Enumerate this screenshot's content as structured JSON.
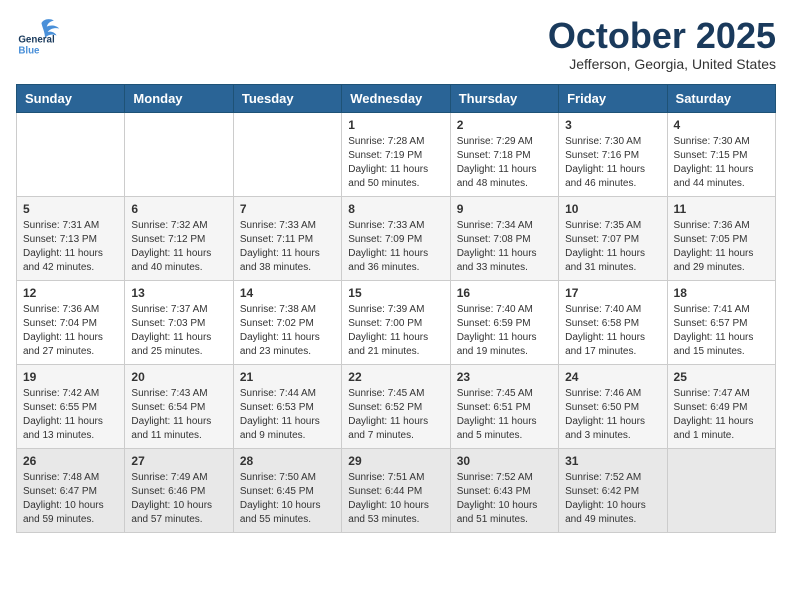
{
  "header": {
    "logo_line1": "General",
    "logo_line2": "Blue",
    "month": "October 2025",
    "location": "Jefferson, Georgia, United States"
  },
  "days_of_week": [
    "Sunday",
    "Monday",
    "Tuesday",
    "Wednesday",
    "Thursday",
    "Friday",
    "Saturday"
  ],
  "weeks": [
    [
      {
        "day": "",
        "info": ""
      },
      {
        "day": "",
        "info": ""
      },
      {
        "day": "",
        "info": ""
      },
      {
        "day": "1",
        "info": "Sunrise: 7:28 AM\nSunset: 7:19 PM\nDaylight: 11 hours\nand 50 minutes."
      },
      {
        "day": "2",
        "info": "Sunrise: 7:29 AM\nSunset: 7:18 PM\nDaylight: 11 hours\nand 48 minutes."
      },
      {
        "day": "3",
        "info": "Sunrise: 7:30 AM\nSunset: 7:16 PM\nDaylight: 11 hours\nand 46 minutes."
      },
      {
        "day": "4",
        "info": "Sunrise: 7:30 AM\nSunset: 7:15 PM\nDaylight: 11 hours\nand 44 minutes."
      }
    ],
    [
      {
        "day": "5",
        "info": "Sunrise: 7:31 AM\nSunset: 7:13 PM\nDaylight: 11 hours\nand 42 minutes."
      },
      {
        "day": "6",
        "info": "Sunrise: 7:32 AM\nSunset: 7:12 PM\nDaylight: 11 hours\nand 40 minutes."
      },
      {
        "day": "7",
        "info": "Sunrise: 7:33 AM\nSunset: 7:11 PM\nDaylight: 11 hours\nand 38 minutes."
      },
      {
        "day": "8",
        "info": "Sunrise: 7:33 AM\nSunset: 7:09 PM\nDaylight: 11 hours\nand 36 minutes."
      },
      {
        "day": "9",
        "info": "Sunrise: 7:34 AM\nSunset: 7:08 PM\nDaylight: 11 hours\nand 33 minutes."
      },
      {
        "day": "10",
        "info": "Sunrise: 7:35 AM\nSunset: 7:07 PM\nDaylight: 11 hours\nand 31 minutes."
      },
      {
        "day": "11",
        "info": "Sunrise: 7:36 AM\nSunset: 7:05 PM\nDaylight: 11 hours\nand 29 minutes."
      }
    ],
    [
      {
        "day": "12",
        "info": "Sunrise: 7:36 AM\nSunset: 7:04 PM\nDaylight: 11 hours\nand 27 minutes."
      },
      {
        "day": "13",
        "info": "Sunrise: 7:37 AM\nSunset: 7:03 PM\nDaylight: 11 hours\nand 25 minutes."
      },
      {
        "day": "14",
        "info": "Sunrise: 7:38 AM\nSunset: 7:02 PM\nDaylight: 11 hours\nand 23 minutes."
      },
      {
        "day": "15",
        "info": "Sunrise: 7:39 AM\nSunset: 7:00 PM\nDaylight: 11 hours\nand 21 minutes."
      },
      {
        "day": "16",
        "info": "Sunrise: 7:40 AM\nSunset: 6:59 PM\nDaylight: 11 hours\nand 19 minutes."
      },
      {
        "day": "17",
        "info": "Sunrise: 7:40 AM\nSunset: 6:58 PM\nDaylight: 11 hours\nand 17 minutes."
      },
      {
        "day": "18",
        "info": "Sunrise: 7:41 AM\nSunset: 6:57 PM\nDaylight: 11 hours\nand 15 minutes."
      }
    ],
    [
      {
        "day": "19",
        "info": "Sunrise: 7:42 AM\nSunset: 6:55 PM\nDaylight: 11 hours\nand 13 minutes."
      },
      {
        "day": "20",
        "info": "Sunrise: 7:43 AM\nSunset: 6:54 PM\nDaylight: 11 hours\nand 11 minutes."
      },
      {
        "day": "21",
        "info": "Sunrise: 7:44 AM\nSunset: 6:53 PM\nDaylight: 11 hours\nand 9 minutes."
      },
      {
        "day": "22",
        "info": "Sunrise: 7:45 AM\nSunset: 6:52 PM\nDaylight: 11 hours\nand 7 minutes."
      },
      {
        "day": "23",
        "info": "Sunrise: 7:45 AM\nSunset: 6:51 PM\nDaylight: 11 hours\nand 5 minutes."
      },
      {
        "day": "24",
        "info": "Sunrise: 7:46 AM\nSunset: 6:50 PM\nDaylight: 11 hours\nand 3 minutes."
      },
      {
        "day": "25",
        "info": "Sunrise: 7:47 AM\nSunset: 6:49 PM\nDaylight: 11 hours\nand 1 minute."
      }
    ],
    [
      {
        "day": "26",
        "info": "Sunrise: 7:48 AM\nSunset: 6:47 PM\nDaylight: 10 hours\nand 59 minutes."
      },
      {
        "day": "27",
        "info": "Sunrise: 7:49 AM\nSunset: 6:46 PM\nDaylight: 10 hours\nand 57 minutes."
      },
      {
        "day": "28",
        "info": "Sunrise: 7:50 AM\nSunset: 6:45 PM\nDaylight: 10 hours\nand 55 minutes."
      },
      {
        "day": "29",
        "info": "Sunrise: 7:51 AM\nSunset: 6:44 PM\nDaylight: 10 hours\nand 53 minutes."
      },
      {
        "day": "30",
        "info": "Sunrise: 7:52 AM\nSunset: 6:43 PM\nDaylight: 10 hours\nand 51 minutes."
      },
      {
        "day": "31",
        "info": "Sunrise: 7:52 AM\nSunset: 6:42 PM\nDaylight: 10 hours\nand 49 minutes."
      },
      {
        "day": "",
        "info": ""
      }
    ]
  ]
}
